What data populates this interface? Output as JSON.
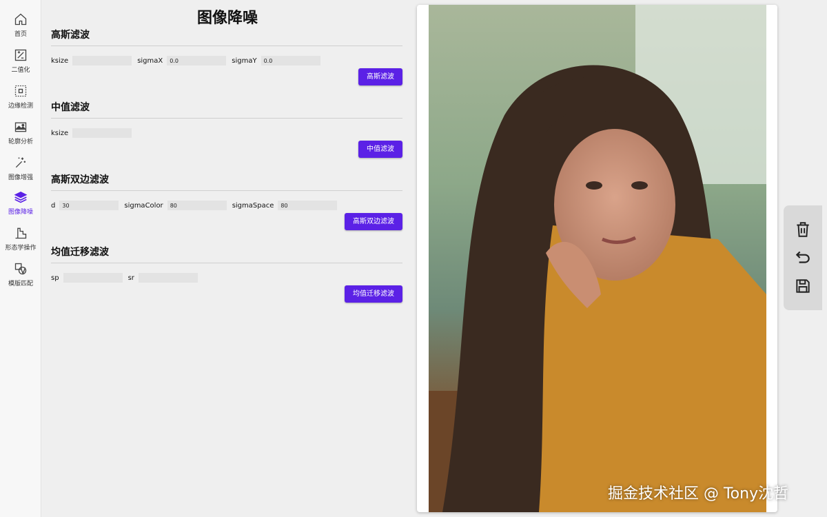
{
  "sidebar": {
    "items": [
      {
        "label": "首页",
        "icon": "home-icon"
      },
      {
        "label": "二值化",
        "icon": "binarize-icon"
      },
      {
        "label": "边缘检测",
        "icon": "edge-detect-icon"
      },
      {
        "label": "轮廓分析",
        "icon": "contour-icon"
      },
      {
        "label": "图像增强",
        "icon": "magic-wand-icon"
      },
      {
        "label": "图像降噪",
        "icon": "layers-icon",
        "active": true
      },
      {
        "label": "形态学操作",
        "icon": "morphology-icon"
      },
      {
        "label": "模版匹配",
        "icon": "template-match-icon"
      }
    ],
    "active_color": "#5b21e6"
  },
  "page": {
    "title": "图像降噪"
  },
  "sections": [
    {
      "title": "高斯滤波",
      "params": [
        {
          "label": "ksize",
          "value": ""
        },
        {
          "label": "sigmaX",
          "value": "0.0"
        },
        {
          "label": "sigmaY",
          "value": "0.0"
        }
      ],
      "button": "高斯滤波"
    },
    {
      "title": "中值滤波",
      "params": [
        {
          "label": "ksize",
          "value": ""
        }
      ],
      "button": "中值滤波"
    },
    {
      "title": "高斯双边滤波",
      "params": [
        {
          "label": "d",
          "value": "30"
        },
        {
          "label": "sigmaColor",
          "value": "80"
        },
        {
          "label": "sigmaSpace",
          "value": "80"
        }
      ],
      "button": "高斯双边滤波"
    },
    {
      "title": "均值迁移滤波",
      "params": [
        {
          "label": "sp",
          "value": ""
        },
        {
          "label": "sr",
          "value": ""
        }
      ],
      "button": "均值迁移滤波"
    }
  ],
  "toolbar": {
    "icons": [
      "trash-icon",
      "undo-icon",
      "save-icon"
    ]
  },
  "watermark": "掘金技术社区 @ Tony沈哲",
  "accent": "#5b21e6"
}
